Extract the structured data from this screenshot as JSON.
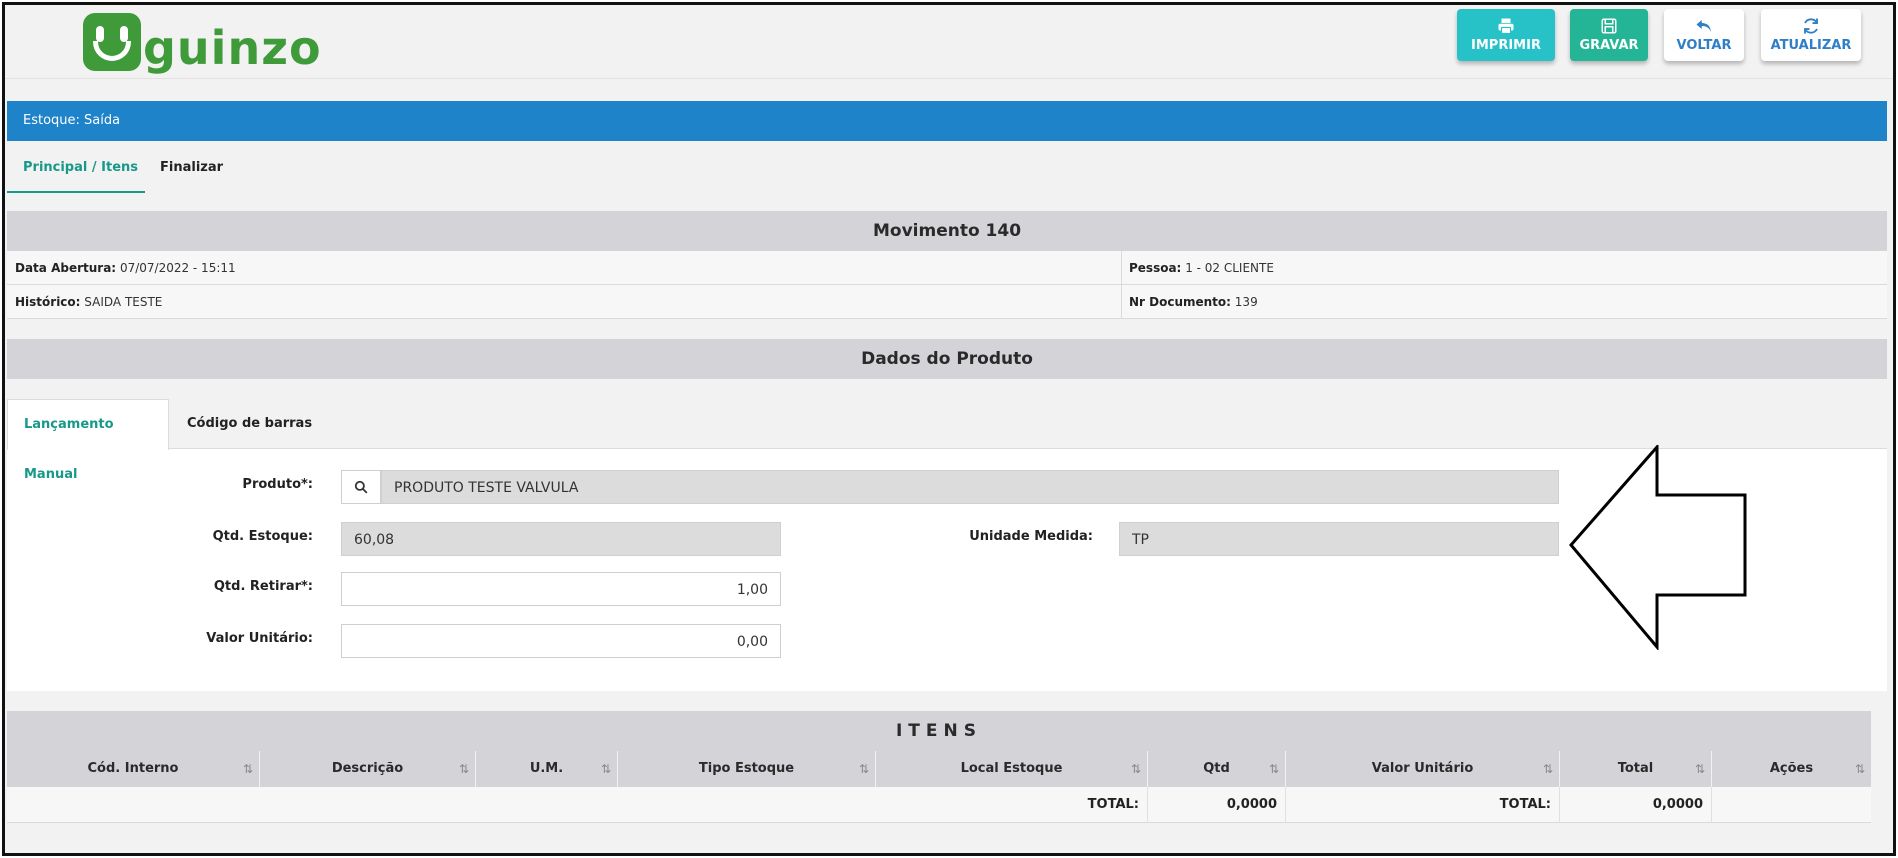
{
  "header": {
    "logo_text": "guinzo",
    "buttons": {
      "print": "IMPRIMIR",
      "save": "GRAVAR",
      "back": "VOLTAR",
      "refresh": "ATUALIZAR"
    }
  },
  "title_bar": "Estoque: Saída",
  "main_tabs": [
    "Principal / Itens",
    "Finalizar"
  ],
  "movimento": {
    "title": "Movimento 140",
    "data_abertura_label": "Data Abertura:",
    "data_abertura": "07/07/2022 - 15:11",
    "pessoa_label": "Pessoa:",
    "pessoa": "1 - 02 CLIENTE",
    "historico_label": "Histórico:",
    "historico": "SAIDA TESTE",
    "nr_documento_label": "Nr Documento:",
    "nr_documento": "139"
  },
  "produto": {
    "title": "Dados do Produto",
    "tabs": [
      "Lançamento Manual",
      "Código de barras"
    ],
    "produto_label": "Produto*:",
    "produto_value": "PRODUTO TESTE VALVULA",
    "qtd_estoque_label": "Qtd. Estoque:",
    "qtd_estoque": "60,08",
    "unidade_label": "Unidade Medida:",
    "unidade": "TP",
    "qtd_retirar_label": "Qtd. Retirar*:",
    "qtd_retirar": "1,00",
    "valor_unitario_label": "Valor Unitário:",
    "valor_unitario": "0,00"
  },
  "itens": {
    "title": "ITENS",
    "columns": [
      "Cód. Interno",
      "Descrição",
      "U.M.",
      "Tipo Estoque",
      "Local Estoque",
      "Qtd",
      "Valor Unitário",
      "Total",
      "Ações"
    ],
    "footer": {
      "total_label_1": "TOTAL:",
      "qtd_total": "0,0000",
      "total_label_2": "TOTAL:",
      "valor_total": "0,0000"
    }
  },
  "colors": {
    "brand_green": "#3f9a3a",
    "title_blue": "#1e83c9",
    "tab_active": "#17998a",
    "print_btn": "#26c2c8",
    "save_btn": "#23b596"
  }
}
